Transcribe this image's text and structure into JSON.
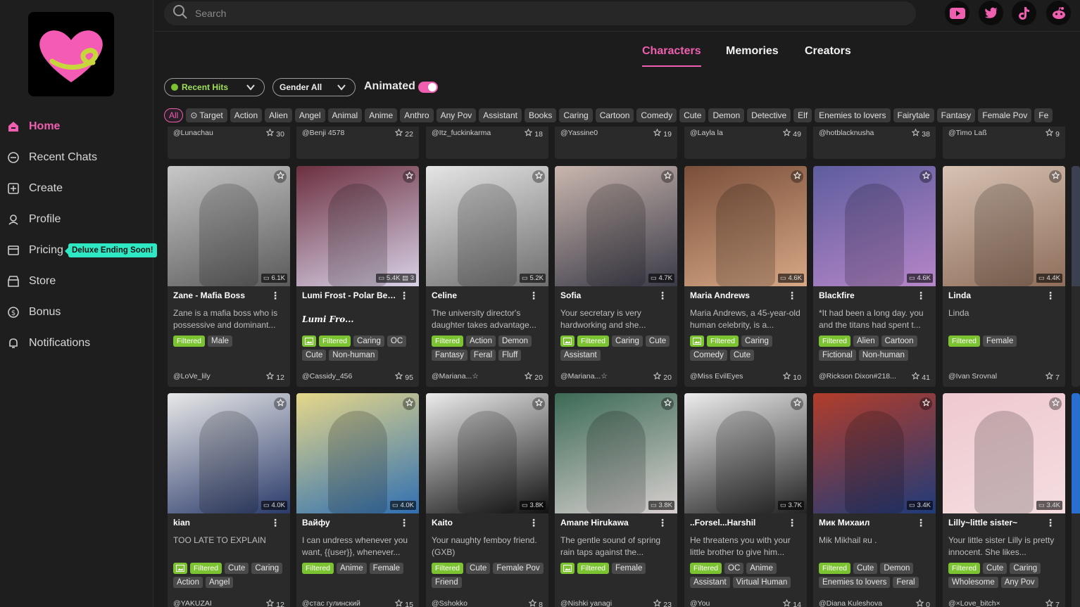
{
  "sidebar": {
    "items": [
      {
        "label": "Home",
        "icon": "home-icon"
      },
      {
        "label": "Recent Chats",
        "icon": "chat-icon"
      },
      {
        "label": "Create",
        "icon": "plus-square-icon"
      },
      {
        "label": "Profile",
        "icon": "profile-icon"
      },
      {
        "label": "Pricing",
        "icon": "pricing-icon"
      },
      {
        "label": "Store",
        "icon": "store-icon"
      },
      {
        "label": "Bonus",
        "icon": "dollar-icon"
      },
      {
        "label": "Notifications",
        "icon": "bell-icon"
      }
    ],
    "pricing_badge": "Deluxe Ending Soon!"
  },
  "search": {
    "placeholder": "Search"
  },
  "tabs": [
    "Characters",
    "Memories",
    "Creators"
  ],
  "filters": {
    "sort": "Recent Hits",
    "gender": "Gender All",
    "animated_label": "Animated"
  },
  "tags": [
    "All",
    "Target",
    "Action",
    "Alien",
    "Angel",
    "Animal",
    "Anime",
    "Anthro",
    "Any Pov",
    "Assistant",
    "Books",
    "Caring",
    "Cartoon",
    "Comedy",
    "Cute",
    "Demon",
    "Detective",
    "Elf",
    "Enemies to lovers",
    "Fairytale",
    "Fantasy",
    "Female Pov",
    "Fe"
  ],
  "top_row": [
    {
      "creator": "@Lunachau",
      "favs": "30"
    },
    {
      "creator": "@Benji 4578",
      "favs": "22"
    },
    {
      "creator": "@Itz_fuckinkarma",
      "favs": "18"
    },
    {
      "creator": "@Yassine0",
      "favs": "19"
    },
    {
      "creator": "@Layla la",
      "favs": "49"
    },
    {
      "creator": "@hotblacknusha",
      "favs": "38"
    },
    {
      "creator": "@Timo Laß",
      "favs": "9"
    }
  ],
  "row2": [
    {
      "name": "Zane - Mafia Boss",
      "chats": "6.1K",
      "desc": "Zane is a mafia boss who is possessive and dominant...",
      "tags": [
        "Filtered",
        "Male"
      ],
      "creator": "@LoVe_lily",
      "favs": "12"
    },
    {
      "name": "Lumi Frost - Polar Bear ...",
      "chats": "5.4K",
      "extra": "3",
      "desc": "Lumi Fro...",
      "tags": [
        "img",
        "Filtered",
        "Caring",
        "OC",
        "Cute",
        "Non-human"
      ],
      "creator": "@Cassidy_456",
      "favs": "95"
    },
    {
      "name": "Celine",
      "chats": "5.2K",
      "desc": "The university director's daughter takes advantage...",
      "tags": [
        "Filtered",
        "Action",
        "Demon",
        "Fantasy",
        "Feral",
        "Fluff"
      ],
      "creator": "@Mariana...☆",
      "favs": "20"
    },
    {
      "name": "Sofia",
      "chats": "4.7K",
      "desc": "Your secretary is very hardworking and she...",
      "tags": [
        "img",
        "Filtered",
        "Caring",
        "Cute",
        "Assistant"
      ],
      "creator": "@Mariana...☆",
      "favs": "20"
    },
    {
      "name": "Maria Andrews",
      "chats": "4.6K",
      "desc": "Maria Andrews, a 45-year-old human celebrity, is a...",
      "tags": [
        "img",
        "Filtered",
        "Caring",
        "Comedy",
        "Cute"
      ],
      "creator": "@Miss EvilEyes",
      "favs": "10"
    },
    {
      "name": "Blackfire",
      "chats": "4.6K",
      "desc": "*It had been a long day. you and the titans had spent t...",
      "tags": [
        "Filtered",
        "Alien",
        "Cartoon",
        "Fictional",
        "Non-human"
      ],
      "creator": "@Rickson Dixon#218...",
      "favs": "41"
    },
    {
      "name": "Linda",
      "chats": "4.4K",
      "desc": "Linda",
      "tags": [
        "Filtered",
        "Female"
      ],
      "creator": "@Ivan Srovnal",
      "favs": "7"
    }
  ],
  "row3": [
    {
      "name": "kian",
      "chats": "4.0K",
      "desc": "TOO LATE TO EXPLAIN",
      "tags": [
        "img",
        "Filtered",
        "Cute",
        "Caring",
        "Action",
        "Angel"
      ],
      "creator": "@YAKUZAI",
      "favs": "12"
    },
    {
      "name": "Вайфу",
      "chats": "4.0K",
      "desc": "I can undress whenever you want, {{user}}, whenever...",
      "tags": [
        "Filtered",
        "Anime",
        "Female"
      ],
      "creator": "@стас гулинский",
      "favs": "15"
    },
    {
      "name": "Kaito",
      "chats": "3.8K",
      "desc": "Your naughty femboy friend. (GXB)",
      "tags": [
        "Filtered",
        "Cute",
        "Female Pov",
        "Friend"
      ],
      "creator": "@Sshokko",
      "favs": "8"
    },
    {
      "name": "Amane Hirukawa",
      "chats": "3.8K",
      "desc": "The gentle sound of spring rain taps against the...",
      "tags": [
        "img",
        "Filtered",
        "Female"
      ],
      "creator": "@Nishki yanagi",
      "favs": "23"
    },
    {
      "name": "..Forsel...Harshil",
      "chats": "3.7K",
      "desc": "He threatens you with your little brother to give him...",
      "tags": [
        "Filtered",
        "OC",
        "Anime",
        "Assistant",
        "Virtual Human"
      ],
      "creator": "@You",
      "favs": "14"
    },
    {
      "name": "Мик Михаил",
      "chats": "3.4K",
      "desc": "Mik Mikhail ʀu .",
      "tags": [
        "Filtered",
        "Cute",
        "Demon",
        "Enemies to lovers",
        "Feral"
      ],
      "creator": "@Diana Kuleshova",
      "favs": "0"
    },
    {
      "name": "Lilly~little sister~",
      "chats": "3.4K",
      "desc": "Your little sister Lilly is pretty innocent. She likes...",
      "tags": [
        "Filtered",
        "Cute",
        "Caring",
        "Wholesome",
        "Any Pov"
      ],
      "creator": "@×Love_bitch×",
      "favs": "7"
    }
  ],
  "colors": {
    "accent": "#ef5fb0",
    "filtered": "#7cc332",
    "badge": "#2de8c2"
  }
}
